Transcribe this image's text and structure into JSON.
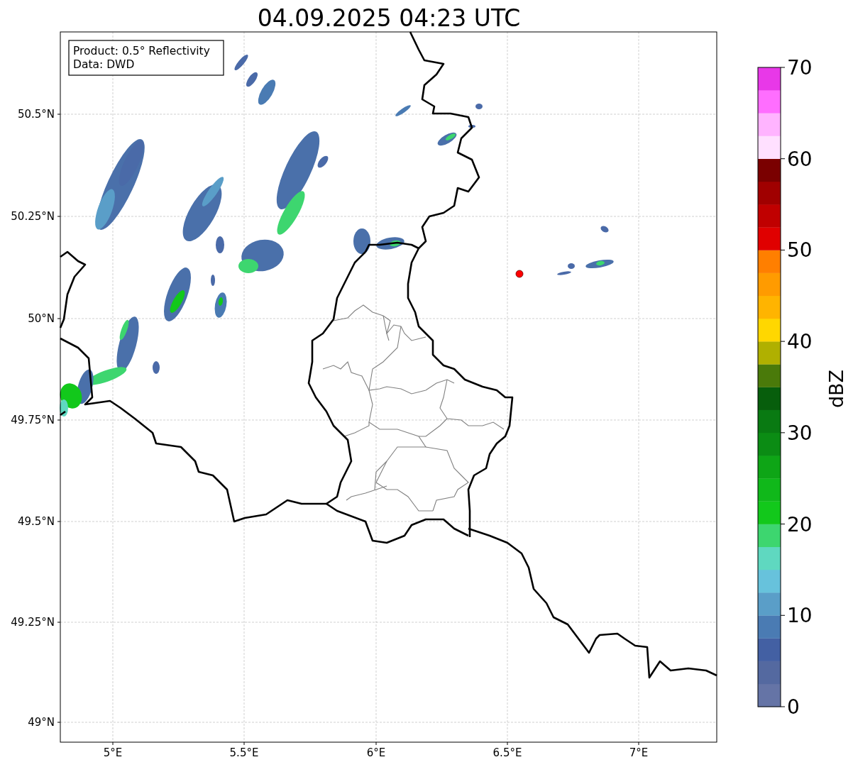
{
  "title": "04.09.2025 04:23 UTC",
  "map": {
    "info_box": [
      "Product: 0.5° Reflectivity",
      "Data: DWD"
    ],
    "x_ticks": [
      "5°E",
      "5.5°E",
      "6°E",
      "6.5°E",
      "7°E"
    ],
    "y_ticks": [
      "50.5°N",
      "50.25°N",
      "50°N",
      "49.75°N",
      "49.5°N",
      "49.25°N",
      "49°N"
    ]
  },
  "colorbar": {
    "label": "dBZ",
    "ticks": [
      "70",
      "60",
      "50",
      "40",
      "30",
      "20",
      "10",
      "0"
    ],
    "segments": [
      {
        "color": "#6574a6"
      },
      {
        "color": "#5469a0"
      },
      {
        "color": "#4360a3"
      },
      {
        "color": "#4a7bb3"
      },
      {
        "color": "#5a9ec8"
      },
      {
        "color": "#67c2dc"
      },
      {
        "color": "#5fd8c0"
      },
      {
        "color": "#3dd66f"
      },
      {
        "color": "#12c81b"
      },
      {
        "color": "#10b81a"
      },
      {
        "color": "#0ea516"
      },
      {
        "color": "#0b8c14"
      },
      {
        "color": "#097a12"
      },
      {
        "color": "#075e0c"
      },
      {
        "color": "#4a7a0a"
      },
      {
        "color": "#b0b000"
      },
      {
        "color": "#ffd700"
      },
      {
        "color": "#ffb400"
      },
      {
        "color": "#ff9b00"
      },
      {
        "color": "#ff7f00"
      },
      {
        "color": "#e00000"
      },
      {
        "color": "#c00000"
      },
      {
        "color": "#a00000"
      },
      {
        "color": "#7a0000"
      },
      {
        "color": "#ffe0ff"
      },
      {
        "color": "#ffb4ff"
      },
      {
        "color": "#ff6eff"
      },
      {
        "color": "#e838e8"
      }
    ]
  }
}
